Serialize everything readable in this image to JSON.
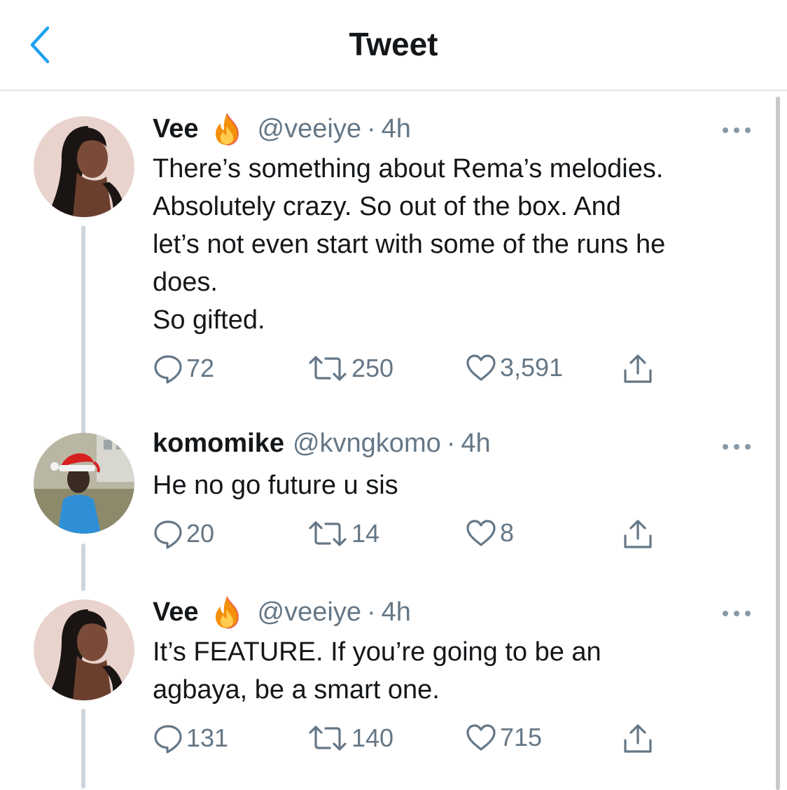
{
  "header": {
    "title": "Tweet",
    "back_icon": "chevron-left-icon"
  },
  "colors": {
    "accent": "#1da1f2",
    "secondary_text": "#657786",
    "divider": "#e1e8ed",
    "thread_line": "#cdd5dc"
  },
  "tweets": [
    {
      "name": "Vee",
      "has_fire_emoji": true,
      "handle": "@veeiye",
      "separator": "·",
      "time": "4h",
      "text_lines": [
        "There’s something about Rema’s melodies.",
        "Absolutely crazy. So out of the box. And",
        "let’s not even start with some of the runs he",
        "does.",
        "So gifted."
      ],
      "replies": "72",
      "retweets": "250",
      "likes": "3,591"
    },
    {
      "name": "komomike",
      "has_fire_emoji": false,
      "handle": "@kvngkomo",
      "separator": "·",
      "time": "4h",
      "text_lines": [
        "He no go future u sis"
      ],
      "replies": "20",
      "retweets": "14",
      "likes": "8"
    },
    {
      "name": "Vee",
      "has_fire_emoji": true,
      "handle": "@veeiye",
      "separator": "·",
      "time": "4h",
      "text_lines": [
        "It’s FEATURE. If you’re going to be an",
        "agbaya, be a smart one."
      ],
      "replies": "131",
      "retweets": "140",
      "likes": "715"
    }
  ]
}
